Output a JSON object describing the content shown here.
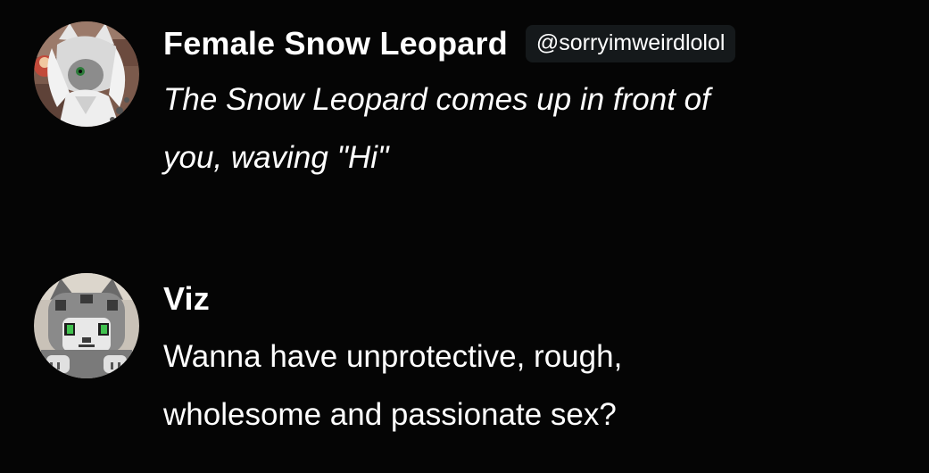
{
  "messages": [
    {
      "name": "Female Snow Leopard",
      "handle": "@sorryimweirdlolol",
      "avatar_icon": "snow-leopard-avatar-icon",
      "text_lines": [
        "The Snow Leopard comes up in front of",
        "you, waving \"Hi\""
      ],
      "italic": true
    },
    {
      "name": "Viz",
      "avatar_icon": "pixel-cat-avatar-icon",
      "text_lines": [
        "Wanna have unprotective, rough,",
        "wholesome and passionate sex?"
      ],
      "italic": false
    }
  ],
  "colors": {
    "background": "#050505",
    "text": "#ffffff",
    "handle_badge_bg": "#15191b"
  }
}
